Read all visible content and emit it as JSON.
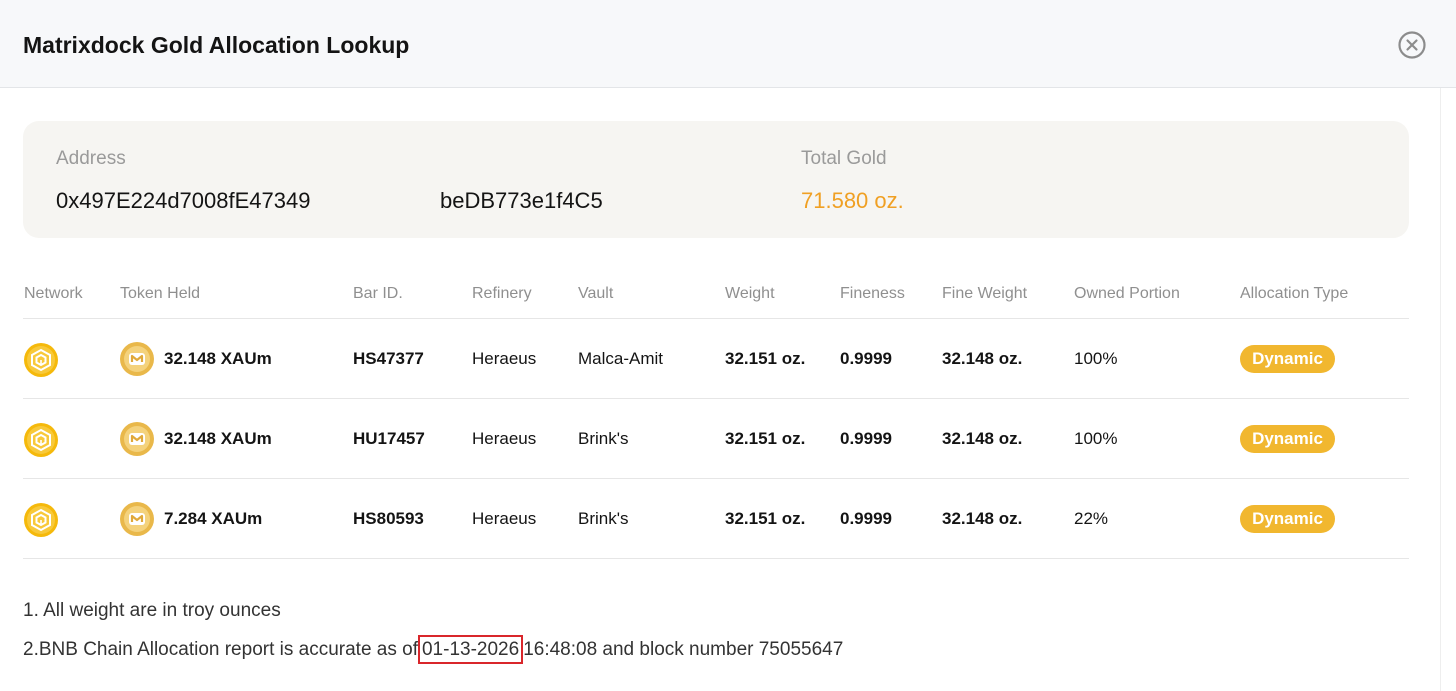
{
  "header": {
    "title": "Matrixdock Gold Allocation Lookup",
    "close_icon": "close-circle-icon"
  },
  "summary": {
    "address_label": "Address",
    "address_part1": "0x497E224d7008fE47349",
    "address_part2": "beDB773e1f4C5",
    "total_label": "Total Gold",
    "total_value": "71.580 oz."
  },
  "table": {
    "columns": [
      "Network",
      "Token Held",
      "Bar ID.",
      "Refinery",
      "Vault",
      "Weight",
      "Fineness",
      "Fine Weight",
      "Owned Portion",
      "Allocation Type"
    ],
    "rows": [
      {
        "network_icon": "bnb-chain-icon",
        "token_icon": "xaum-token-icon",
        "token": "32.148 XAUm",
        "bar_id": "HS47377",
        "refinery": "Heraeus",
        "vault": "Malca-Amit",
        "weight": "32.151 oz.",
        "fineness": "0.9999",
        "fine_weight": "32.148 oz.",
        "owned": "100%",
        "allocation": "Dynamic"
      },
      {
        "network_icon": "bnb-chain-icon",
        "token_icon": "xaum-token-icon",
        "token": "32.148 XAUm",
        "bar_id": "HU17457",
        "refinery": "Heraeus",
        "vault": "Brink's",
        "weight": "32.151 oz.",
        "fineness": "0.9999",
        "fine_weight": "32.148 oz.",
        "owned": "100%",
        "allocation": "Dynamic"
      },
      {
        "network_icon": "bnb-chain-icon",
        "token_icon": "xaum-token-icon",
        "token": "7.284 XAUm",
        "bar_id": "HS80593",
        "refinery": "Heraeus",
        "vault": "Brink's",
        "weight": "32.151 oz.",
        "fineness": "0.9999",
        "fine_weight": "32.148 oz.",
        "owned": "22%",
        "allocation": "Dynamic"
      }
    ]
  },
  "notes": {
    "note1": "1. All weight are in troy ounces",
    "note2_prefix": "2.BNB Chain Allocation report is accurate as of",
    "note2_date": "01-13-2026",
    "note2_suffix": "16:48:08 and block number 75055647"
  },
  "colors": {
    "gold_text": "#f0a024",
    "badge": "#f1b72f",
    "highlight_border": "#d9262b",
    "summary_bg": "#f6f5f2"
  }
}
